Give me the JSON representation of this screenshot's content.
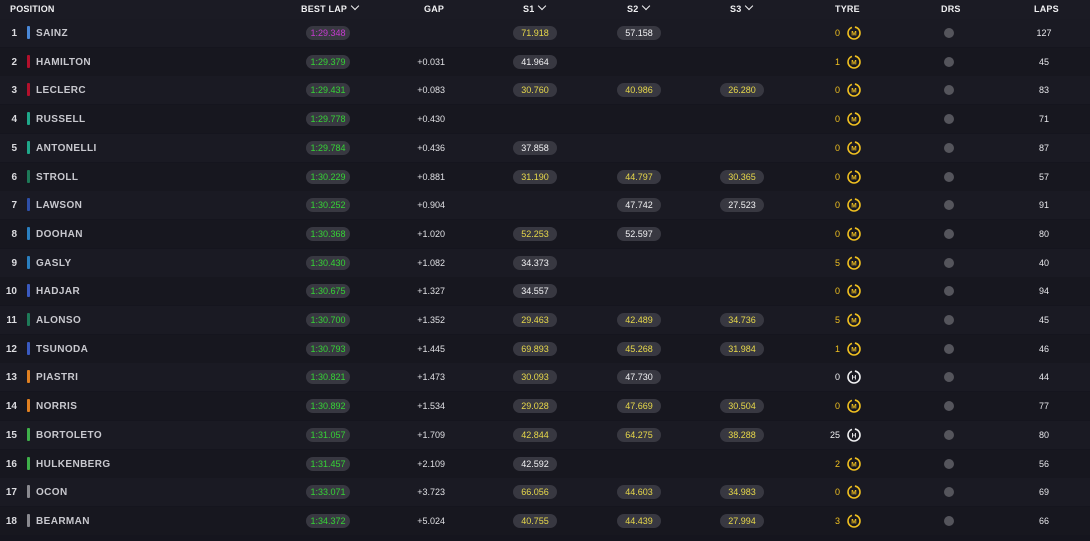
{
  "header": {
    "position": "POSITION",
    "best_lap": "BEST LAP",
    "gap": "GAP",
    "s1": "S1",
    "s2": "S2",
    "s3": "S3",
    "tyre": "TYRE",
    "drs": "DRS",
    "laps": "LAPS"
  },
  "colors": {
    "background": "#15151e",
    "best_lap_green": "#35d435",
    "best_lap_purple": "#c63bd0",
    "sector_yellow": "#e8d94a",
    "medium_tyre": "#f0c020",
    "hard_tyre": "#f0f0f2"
  },
  "rows": [
    {
      "pos": "1",
      "team_color": "#4a88d8",
      "name": "SAINZ",
      "best": "1:29.348",
      "best_purple": true,
      "gap": "",
      "s1": "71.918",
      "s1c": "y",
      "s2": "57.158",
      "s2c": "w",
      "s3": "",
      "s3c": "",
      "tyre_laps": "0",
      "tyre": "medium-tyre-icon",
      "drs": "off",
      "laps": "127"
    },
    {
      "pos": "2",
      "team_color": "#b3102c",
      "name": "HAMILTON",
      "best": "1:29.379",
      "gap": "+0.031",
      "s1": "41.964",
      "s1c": "w",
      "s2": "",
      "s2c": "",
      "s3": "",
      "s3c": "",
      "tyre_laps": "1",
      "tyre": "medium-tyre-icon",
      "drs": "off",
      "laps": "45"
    },
    {
      "pos": "3",
      "team_color": "#b3102c",
      "name": "LECLERC",
      "best": "1:29.431",
      "gap": "+0.083",
      "s1": "30.760",
      "s1c": "y",
      "s2": "40.986",
      "s2c": "y",
      "s3": "26.280",
      "s3c": "y",
      "tyre_laps": "0",
      "tyre": "medium-tyre-icon",
      "drs": "off",
      "laps": "83"
    },
    {
      "pos": "4",
      "team_color": "#1fa88a",
      "name": "RUSSELL",
      "best": "1:29.778",
      "gap": "+0.430",
      "s1": "",
      "s1c": "",
      "s2": "",
      "s2c": "",
      "s3": "",
      "s3c": "",
      "tyre_laps": "0",
      "tyre": "medium-tyre-icon",
      "drs": "off",
      "laps": "71"
    },
    {
      "pos": "5",
      "team_color": "#1fa88a",
      "name": "ANTONELLI",
      "best": "1:29.784",
      "gap": "+0.436",
      "s1": "37.858",
      "s1c": "w",
      "s2": "",
      "s2c": "",
      "s3": "",
      "s3c": "",
      "tyre_laps": "0",
      "tyre": "medium-tyre-icon",
      "drs": "off",
      "laps": "87"
    },
    {
      "pos": "6",
      "team_color": "#1e7a58",
      "name": "STROLL",
      "best": "1:30.229",
      "gap": "+0.881",
      "s1": "31.190",
      "s1c": "y",
      "s2": "44.797",
      "s2c": "y",
      "s3": "30.365",
      "s3c": "y",
      "tyre_laps": "0",
      "tyre": "medium-tyre-icon",
      "drs": "off",
      "laps": "57"
    },
    {
      "pos": "7",
      "team_color": "#2e4fa8",
      "name": "LAWSON",
      "best": "1:30.252",
      "gap": "+0.904",
      "s1": "",
      "s1c": "",
      "s2": "47.742",
      "s2c": "w",
      "s3": "27.523",
      "s3c": "w",
      "tyre_laps": "0",
      "tyre": "medium-tyre-icon",
      "drs": "off",
      "laps": "91"
    },
    {
      "pos": "8",
      "team_color": "#2a7fc0",
      "name": "DOOHAN",
      "best": "1:30.368",
      "gap": "+1.020",
      "s1": "52.253",
      "s1c": "y",
      "s2": "52.597",
      "s2c": "w",
      "s3": "",
      "s3c": "",
      "tyre_laps": "0",
      "tyre": "medium-tyre-icon",
      "drs": "off",
      "laps": "80"
    },
    {
      "pos": "9",
      "team_color": "#2a7fc0",
      "name": "GASLY",
      "best": "1:30.430",
      "gap": "+1.082",
      "s1": "34.373",
      "s1c": "w",
      "s2": "",
      "s2c": "",
      "s3": "",
      "s3c": "",
      "tyre_laps": "5",
      "tyre": "medium-tyre-icon",
      "drs": "off",
      "laps": "40"
    },
    {
      "pos": "10",
      "team_color": "#3a5ac0",
      "name": "HADJAR",
      "best": "1:30.675",
      "gap": "+1.327",
      "s1": "34.557",
      "s1c": "w",
      "s2": "",
      "s2c": "",
      "s3": "",
      "s3c": "",
      "tyre_laps": "0",
      "tyre": "medium-tyre-icon",
      "drs": "off",
      "laps": "94"
    },
    {
      "pos": "11",
      "team_color": "#1e7a58",
      "name": "ALONSO",
      "best": "1:30.700",
      "gap": "+1.352",
      "s1": "29.463",
      "s1c": "y",
      "s2": "42.489",
      "s2c": "y",
      "s3": "34.736",
      "s3c": "y",
      "tyre_laps": "5",
      "tyre": "medium-tyre-icon",
      "drs": "off",
      "laps": "45"
    },
    {
      "pos": "12",
      "team_color": "#3a5ac0",
      "name": "TSUNODA",
      "best": "1:30.793",
      "gap": "+1.445",
      "s1": "69.893",
      "s1c": "y",
      "s2": "45.268",
      "s2c": "y",
      "s3": "31.984",
      "s3c": "y",
      "tyre_laps": "1",
      "tyre": "medium-tyre-icon",
      "drs": "off",
      "laps": "46"
    },
    {
      "pos": "13",
      "team_color": "#e08020",
      "name": "PIASTRI",
      "best": "1:30.821",
      "gap": "+1.473",
      "s1": "30.093",
      "s1c": "y",
      "s2": "47.730",
      "s2c": "w",
      "s3": "",
      "s3c": "",
      "tyre_laps": "0",
      "tyre": "hard-tyre-icon",
      "drs": "off",
      "laps": "44"
    },
    {
      "pos": "14",
      "team_color": "#e08020",
      "name": "NORRIS",
      "best": "1:30.892",
      "gap": "+1.534",
      "s1": "29.028",
      "s1c": "y",
      "s2": "47.669",
      "s2c": "y",
      "s3": "30.504",
      "s3c": "y",
      "tyre_laps": "0",
      "tyre": "medium-tyre-icon",
      "drs": "off",
      "laps": "77"
    },
    {
      "pos": "15",
      "team_color": "#3fb04a",
      "name": "BORTOLETO",
      "best": "1:31.057",
      "gap": "+1.709",
      "s1": "42.844",
      "s1c": "y",
      "s2": "64.275",
      "s2c": "y",
      "s3": "38.288",
      "s3c": "y",
      "tyre_laps": "25",
      "tyre": "hard-tyre-icon",
      "drs": "off",
      "laps": "80"
    },
    {
      "pos": "16",
      "team_color": "#3fb04a",
      "name": "HULKENBERG",
      "best": "1:31.457",
      "gap": "+2.109",
      "s1": "42.592",
      "s1c": "w",
      "s2": "",
      "s2c": "",
      "s3": "",
      "s3c": "",
      "tyre_laps": "2",
      "tyre": "medium-tyre-icon",
      "drs": "off",
      "laps": "56"
    },
    {
      "pos": "17",
      "team_color": "#8a8a90",
      "name": "OCON",
      "best": "1:33.071",
      "gap": "+3.723",
      "s1": "66.056",
      "s1c": "y",
      "s2": "44.603",
      "s2c": "y",
      "s3": "34.983",
      "s3c": "y",
      "tyre_laps": "0",
      "tyre": "medium-tyre-icon",
      "drs": "off",
      "laps": "69"
    },
    {
      "pos": "18",
      "team_color": "#8a8a90",
      "name": "BEARMAN",
      "best": "1:34.372",
      "gap": "+5.024",
      "s1": "40.755",
      "s1c": "y",
      "s2": "44.439",
      "s2c": "y",
      "s3": "27.994",
      "s3c": "y",
      "tyre_laps": "3",
      "tyre": "medium-tyre-icon",
      "drs": "off",
      "laps": "66"
    }
  ]
}
